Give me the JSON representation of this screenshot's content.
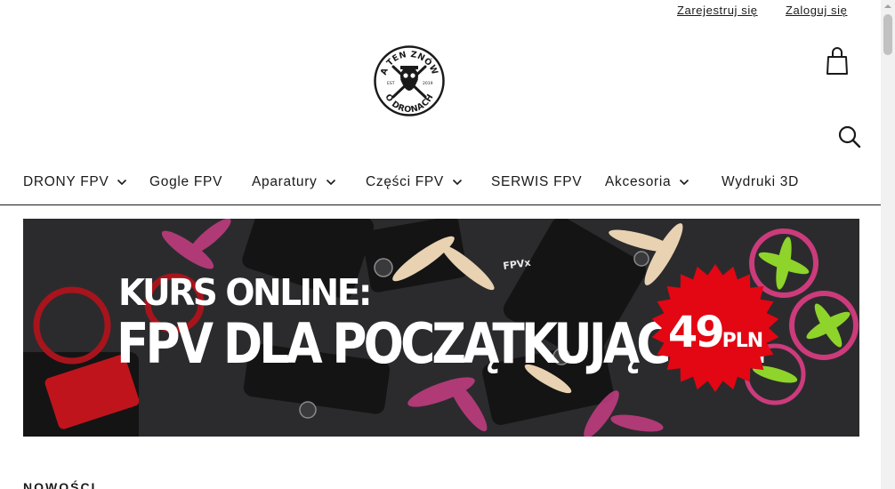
{
  "topbar": {
    "register_label": "Zarejestruj się",
    "login_label": "Zaloguj się"
  },
  "logo": {
    "text_top": "A TEN ZNÓW",
    "text_bottom": "O DRONACH",
    "text_est": "EST",
    "text_year": "2019",
    "icon": "bearded-skull-with-propellers-logo"
  },
  "header_icons": {
    "cart": "shopping-bag-icon",
    "search": "search-icon"
  },
  "nav": {
    "items": [
      {
        "label": "DRONY FPV",
        "has_dropdown": true
      },
      {
        "label": "Gogle FPV",
        "has_dropdown": false
      },
      {
        "label": "Aparatury",
        "has_dropdown": true
      },
      {
        "label": "Części FPV",
        "has_dropdown": true
      },
      {
        "label": "SERWIS FPV",
        "has_dropdown": false
      },
      {
        "label": "Akcesoria",
        "has_dropdown": true
      },
      {
        "label": "Wydruki 3D",
        "has_dropdown": false
      }
    ]
  },
  "banner": {
    "line1": "KURS ONLINE:",
    "line2": "FPV DLA POCZĄTKUJĄCYCH",
    "price_value": "49",
    "price_currency": "PLN",
    "brand_text": "FPVx"
  },
  "section": {
    "title": "NOWOŚCI"
  },
  "colors": {
    "text": "#1a1a1a",
    "banner_bg": "#2b2b2d",
    "price_badge": "#e30613",
    "scrollbar_track": "#f1f1f1",
    "scrollbar_thumb": "#c1c1c1"
  }
}
